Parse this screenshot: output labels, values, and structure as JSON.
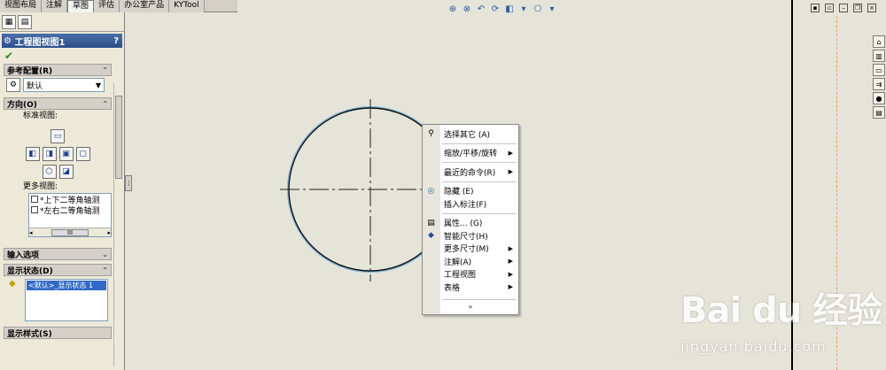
{
  "top_tabs": [
    "视图布局",
    "注解",
    "草图",
    "评估",
    "办公室产品",
    "KYTool"
  ],
  "active_tab_index": 2,
  "left_panel": {
    "title": "工程图视图1",
    "help": "?",
    "sections": {
      "reference_config": {
        "header": "参考配置(R)",
        "value": "默认"
      },
      "orientation": {
        "header": "方向(O)",
        "standard_views_label": "标准视图:",
        "more_views_label": "更多视图:",
        "more_views": [
          "*上下二等角轴测",
          "*左右二等角轴测"
        ],
        "scroll_thumb": "III"
      },
      "import_options": {
        "header": "输入选项"
      },
      "display_state": {
        "header": "显示状态(D)",
        "items": [
          "<默认>_显示状态 1"
        ]
      },
      "display_style": {
        "header": "显示样式(S)"
      }
    }
  },
  "context_menu": {
    "groups": [
      [
        {
          "label": "选择其它 (A)",
          "icon": "select-other-icon",
          "submenu": false
        }
      ],
      [
        {
          "label": "缩放/平移/旋转",
          "submenu": true
        },
        {
          "label": "最近的命令(R)",
          "submenu": true
        }
      ],
      [
        {
          "label": "隐藏 (E)",
          "icon": "hide-icon",
          "submenu": false
        },
        {
          "label": "插入标注(F)",
          "submenu": false
        }
      ],
      [
        {
          "label": "属性... (G)",
          "icon": "properties-icon",
          "submenu": false
        },
        {
          "label": "智能尺寸(H)",
          "icon": "smart-dimension-icon",
          "submenu": false
        },
        {
          "label": "更多尺寸(M)",
          "submenu": true
        },
        {
          "label": "注解(A)",
          "submenu": true
        },
        {
          "label": "工程视图",
          "submenu": true
        },
        {
          "label": "表格",
          "submenu": true
        }
      ]
    ],
    "expand": "»"
  },
  "watermark": {
    "brand": "Bai du 经验",
    "url": "jingyan.baidu.com"
  },
  "colors": {
    "panel": "#ece9d8",
    "canvas": "#e4e4d8",
    "title": "#2a4f8a",
    "selection": "#3169c6",
    "circle_highlight": "#7fb6d9"
  }
}
